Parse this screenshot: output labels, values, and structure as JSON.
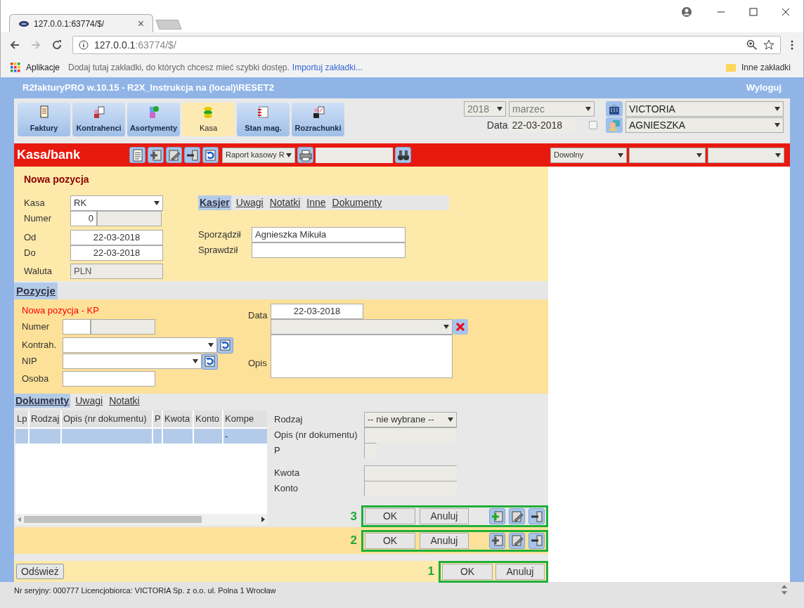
{
  "browser": {
    "tabs": [
      {
        "title": "127.0.0.1:63774/$/",
        "close": "×",
        "selected": true
      }
    ],
    "address": {
      "host": "127.0.0.1",
      "path": ":63774/$/"
    },
    "bookmarks": {
      "apps": "Aplikacje",
      "hint": "Dodaj tutaj zakładki, do których chcesz mieć szybki dostęp.",
      "import_link": "Importuj zakładki...",
      "other": "Inne zakładki"
    }
  },
  "app": {
    "title": "R2fakturyPRO w.10.15 - R2X_Instrukcja na (local)\\RESET2",
    "logout": "Wyloguj"
  },
  "nav": [
    {
      "label": "Faktury",
      "selected": false
    },
    {
      "label": "Kontrahenci",
      "selected": false
    },
    {
      "label": "Asortymenty",
      "selected": false
    },
    {
      "label": "Kasa",
      "selected": true
    },
    {
      "label": "Stan mag.",
      "selected": false
    },
    {
      "label": "Rozrachunki",
      "selected": false
    }
  ],
  "period": {
    "year": "2018",
    "month": "marzec",
    "date_label": "Data",
    "date": "22-03-2018",
    "checked": false,
    "company": "VICTORIA",
    "user": "AGNIESZKA"
  },
  "module": {
    "title": "Kasa/bank",
    "report": "Raport kasowy R",
    "filter": "Dowolny"
  },
  "header": {
    "heading": "Nowa pozycja",
    "tabs": [
      {
        "label": "Kasjer",
        "selected": true
      },
      {
        "label": "Uwagi",
        "selected": false
      },
      {
        "label": "Notatki",
        "selected": false
      },
      {
        "label": "Inne",
        "selected": false
      },
      {
        "label": "Dokumenty",
        "selected": false
      }
    ],
    "kasa": {
      "label": "Kasa",
      "value": "RK"
    },
    "numer": {
      "label": "Numer",
      "value": "0"
    },
    "od": {
      "label": "Od",
      "value": "22-03-2018"
    },
    "do": {
      "label": "Do",
      "value": "22-03-2018"
    },
    "waluta": {
      "label": "Waluta",
      "value": "PLN"
    },
    "sporzadzil": {
      "label": "Sporządził",
      "value": "Agnieszka Mikuła"
    },
    "sprawdzil": {
      "label": "Sprawdził"
    }
  },
  "positions": {
    "tab": {
      "label": "Pozycje",
      "selected": true
    },
    "subtitle": "Nowa pozycja - KP",
    "numer": "Numer",
    "kontrah": "Kontrah.",
    "nip": "NIP",
    "osoba": "Osoba",
    "data_label": "Data",
    "data": "22-03-2018",
    "opis": "Opis"
  },
  "documents": {
    "tabs": [
      {
        "label": "Dokumenty",
        "selected": true
      },
      {
        "label": "Uwagi",
        "selected": false
      },
      {
        "label": "Notatki",
        "selected": false
      }
    ],
    "columns": [
      "Lp",
      "Rodzaj",
      "Opis (nr dokumentu)",
      "P",
      "Kwota",
      "Konto",
      "Kompe"
    ],
    "rows": [
      {
        "selected": true,
        "column_7": "-"
      }
    ],
    "form": {
      "rodzaj": "Rodzaj",
      "rodzaj_value": "-- nie wybrane --",
      "opis": "Opis (nr dokumentu)",
      "p": "P",
      "kwota": "Kwota",
      "konto": "Konto"
    }
  },
  "button_groups": [
    {
      "marker": "3",
      "ok": "OK",
      "cancel": "Anuluj"
    },
    {
      "marker": "2",
      "ok": "OK",
      "cancel": "Anuluj"
    },
    {
      "marker": "1",
      "ok": "OK",
      "cancel": "Anuluj"
    }
  ],
  "refresh": "Odśwież",
  "status_bar": "Nr seryjny: 000777 Licencjobiorca: VICTORIA Sp. z o.o. ul. Polna 1 Wrocław"
}
